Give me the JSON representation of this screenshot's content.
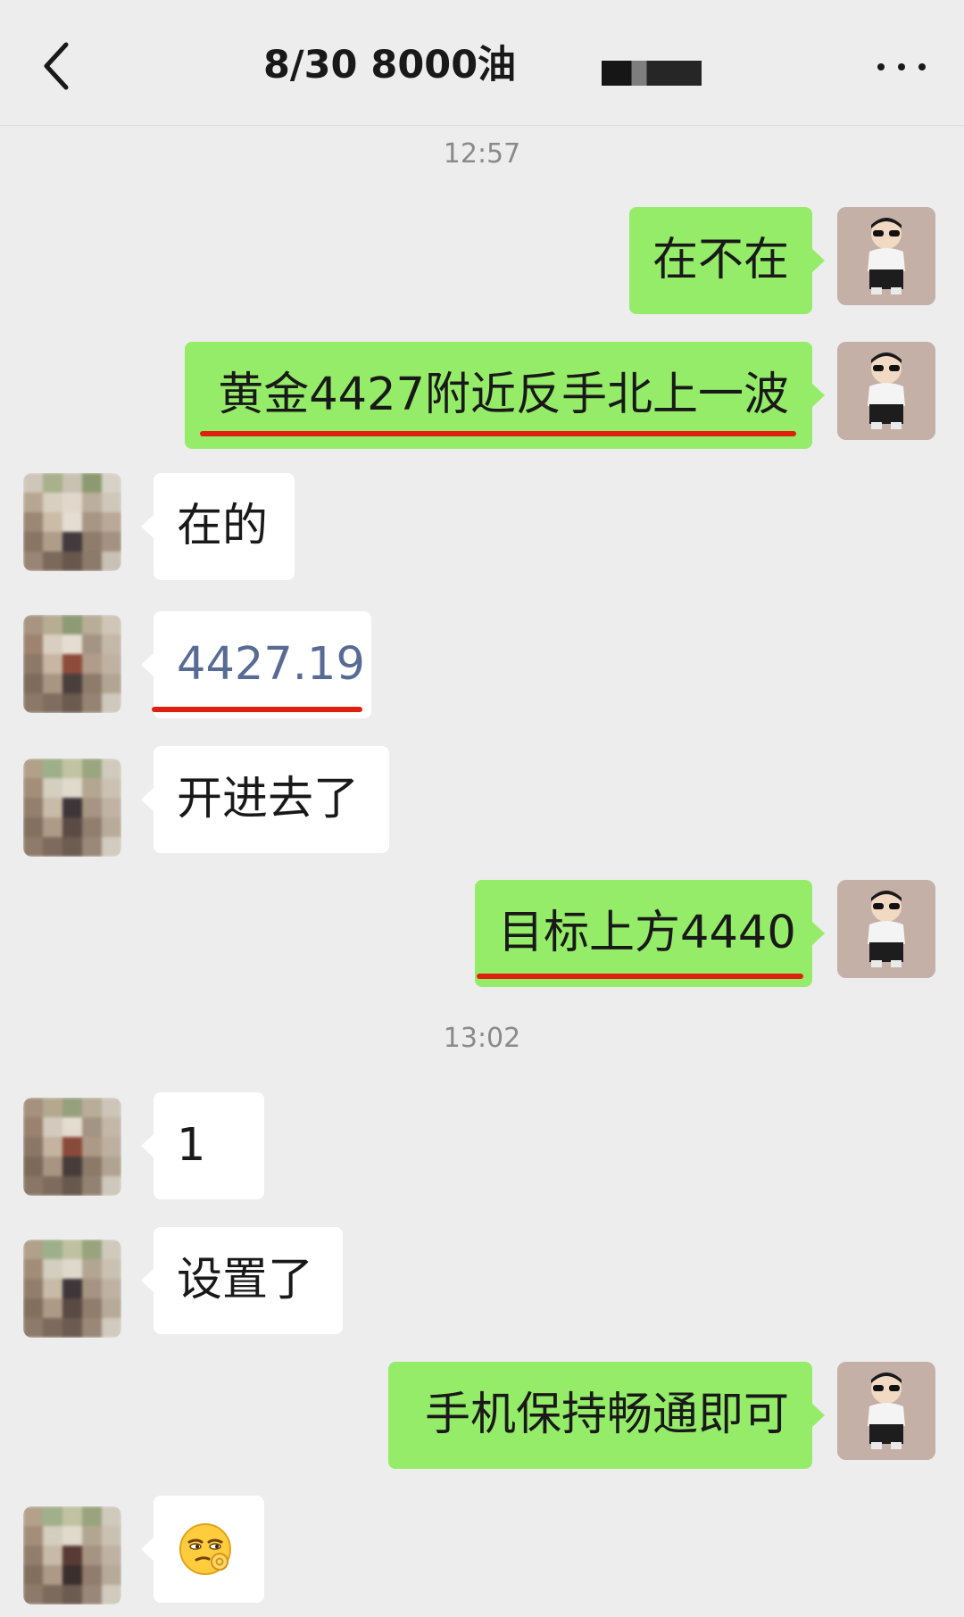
{
  "header": {
    "title": "8/30  8000油",
    "back_icon": "chevron-left-icon",
    "more_icon": "more-dots-icon"
  },
  "colors": {
    "my_bubble": "#95ec69",
    "their_bubble": "#ffffff",
    "background": "#ededed",
    "underline": "#e0200e",
    "link": "#576b95"
  },
  "chat": {
    "timestamps": [
      "12:57",
      "13:02"
    ],
    "messages": [
      {
        "sender": "me",
        "text": "在不在"
      },
      {
        "sender": "me",
        "text": "黄金4427附近反手北上一波"
      },
      {
        "sender": "other",
        "text": "在的"
      },
      {
        "sender": "other",
        "text": "4427.19"
      },
      {
        "sender": "other",
        "text": "开进去了"
      },
      {
        "sender": "me",
        "text": "目标上方4440"
      },
      {
        "sender": "other",
        "text": "1"
      },
      {
        "sender": "other",
        "text": "设置了"
      },
      {
        "sender": "me",
        "text": "手机保持畅通即可"
      },
      {
        "sender": "other",
        "emoji": "smirk-ok-emoji"
      }
    ]
  }
}
